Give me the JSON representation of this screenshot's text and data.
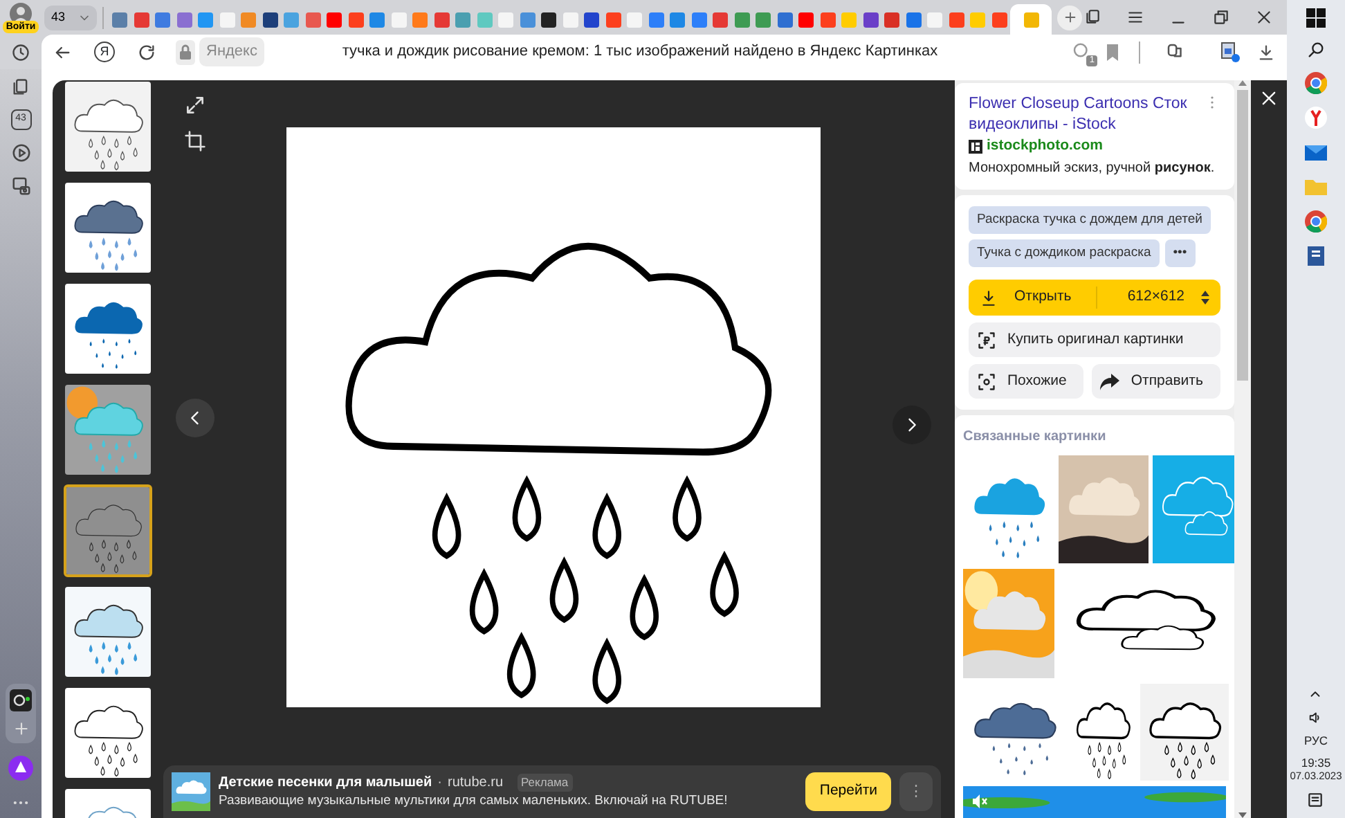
{
  "profile": {
    "label": "Войти"
  },
  "tab_counter": {
    "count": "43"
  },
  "tabs": [
    {
      "color": "#5b7fa8",
      "selected": false
    },
    {
      "color": "#e53935",
      "selected": false
    },
    {
      "color": "#3f7be0",
      "selected": false
    },
    {
      "color": "#8a6fd1",
      "selected": false
    },
    {
      "color": "#2196f3",
      "selected": false
    },
    {
      "color": "#f5f5f5",
      "selected": false
    },
    {
      "color": "#f08a24",
      "selected": false
    },
    {
      "color": "#1d3f7a",
      "selected": false
    },
    {
      "color": "#4aa3df",
      "selected": false
    },
    {
      "color": "#e8584f",
      "selected": false
    },
    {
      "color": "#ff0000",
      "selected": false
    },
    {
      "color": "#fc3f1d",
      "selected": false
    },
    {
      "color": "#1e88e5",
      "selected": false
    },
    {
      "color": "#f5f5f5",
      "selected": false
    },
    {
      "color": "#ff7a1a",
      "selected": false
    },
    {
      "color": "#e53935",
      "selected": false
    },
    {
      "color": "#4b9fb0",
      "selected": false
    },
    {
      "color": "#5fc9c0",
      "selected": false
    },
    {
      "color": "#f5f5f5",
      "selected": false
    },
    {
      "color": "#4a90d9",
      "selected": false
    },
    {
      "color": "#222222",
      "selected": false
    },
    {
      "color": "#f5f5f5",
      "selected": false
    },
    {
      "color": "#2244cc",
      "selected": false
    },
    {
      "color": "#fc3f1d",
      "selected": false
    },
    {
      "color": "#f5f5f5",
      "selected": false
    },
    {
      "color": "#2d7ff9",
      "selected": false
    },
    {
      "color": "#1e88e5",
      "selected": false
    },
    {
      "color": "#2d7ff9",
      "selected": false
    },
    {
      "color": "#e53935",
      "selected": false
    },
    {
      "color": "#3e9b53",
      "selected": false
    },
    {
      "color": "#3e9b53",
      "selected": false
    },
    {
      "color": "#2f6fd1",
      "selected": false
    },
    {
      "color": "#ff0000",
      "selected": false
    },
    {
      "color": "#fc3f1d",
      "selected": false
    },
    {
      "color": "#ffcc00",
      "selected": false
    },
    {
      "color": "#6a3fc8",
      "selected": false
    },
    {
      "color": "#d93025",
      "selected": false
    },
    {
      "color": "#1a73e8",
      "selected": false
    },
    {
      "color": "#f5f5f5",
      "selected": false
    },
    {
      "color": "#fc3f1d",
      "selected": false
    },
    {
      "color": "#ffcc00",
      "selected": false
    },
    {
      "color": "#fc3f1d",
      "selected": false
    },
    {
      "color": "#f2b705",
      "selected": true
    }
  ],
  "address_bar": {
    "logo": "Я",
    "site": "Яндекс",
    "title": "тучка и дождик рисование кремом: 1 тыс изображений найдено в Яндекс Картинках",
    "badge": "1"
  },
  "sidebar": {
    "tabs_count": "43"
  },
  "thumbnails": [
    {
      "selected": false
    },
    {
      "selected": false
    },
    {
      "selected": false
    },
    {
      "selected": false
    },
    {
      "selected": true
    },
    {
      "selected": false
    },
    {
      "selected": false
    },
    {
      "selected": false
    }
  ],
  "info": {
    "title": "Flower Closeup Cartoons Сток видеоклипы - iStock",
    "domain": "istockphoto.com",
    "description": "Монохромный эскиз, ручной **рисунок**.",
    "tags": [
      "Раскраска тучка с дождем для детей",
      "Тучка с дождиком раскраска"
    ],
    "more": "•••",
    "open": "Открыть",
    "size": "612×612",
    "buy": "Купить оригинал картинки",
    "similar": "Похожие",
    "share": "Отправить"
  },
  "related": {
    "title": "Связанные картинки",
    "images": [
      {
        "kind": "picture"
      },
      {
        "kind": "picture"
      },
      {
        "kind": "picture"
      },
      {
        "kind": "picture"
      },
      {
        "kind": "picture"
      },
      {
        "kind": "picture"
      },
      {
        "kind": "picture"
      },
      {
        "kind": "picture"
      },
      {
        "kind": "banner"
      }
    ]
  },
  "ad": {
    "title": "Детские песенки для малышей",
    "separator": "·",
    "domain": "rutube.ru",
    "label": "Реклама",
    "text": "Развивающие музыкальные мультики для самых маленьких. Включай на RUTUBE!",
    "button": "Перейти",
    "menu": "⋮"
  },
  "taskbar": {
    "language": "РУС",
    "time": "19:35",
    "date": "07.03.2023"
  }
}
